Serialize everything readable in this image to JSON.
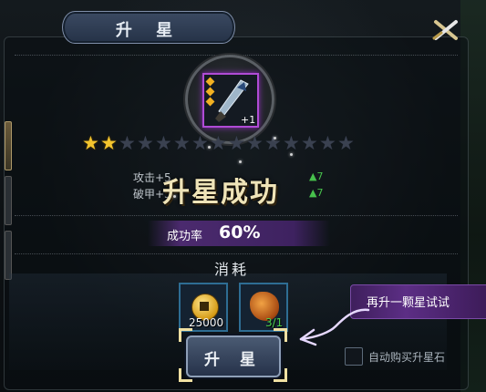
{
  "dialog": {
    "title": "升 星"
  },
  "item": {
    "level_badge": "+1",
    "rank_diamonds": 3
  },
  "stars": {
    "filled": 2,
    "total": 15
  },
  "stats": [
    {
      "label": "攻击+5",
      "arrow_value": "7"
    },
    {
      "label": "破甲+5",
      "arrow_value": "7"
    }
  ],
  "success_banner": "升星成功",
  "success_rate": {
    "label": "成功率",
    "value": "60%"
  },
  "cost": {
    "title": "消耗",
    "gold_amount": "25000",
    "stone_quantity": "3/1"
  },
  "tip_bubble": "再升一颗星试试",
  "upgrade_button": "升 星",
  "auto_buy": {
    "label": "自动购买升星石",
    "checked": false
  },
  "colors": {
    "star_on": "#f2c42e",
    "star_off": "#3a4150",
    "rate_band": "#4b2a6e",
    "slot_border": "#2e6d93",
    "item_rarity": "#b04bd6",
    "positive_arrow": "#47c04c"
  }
}
